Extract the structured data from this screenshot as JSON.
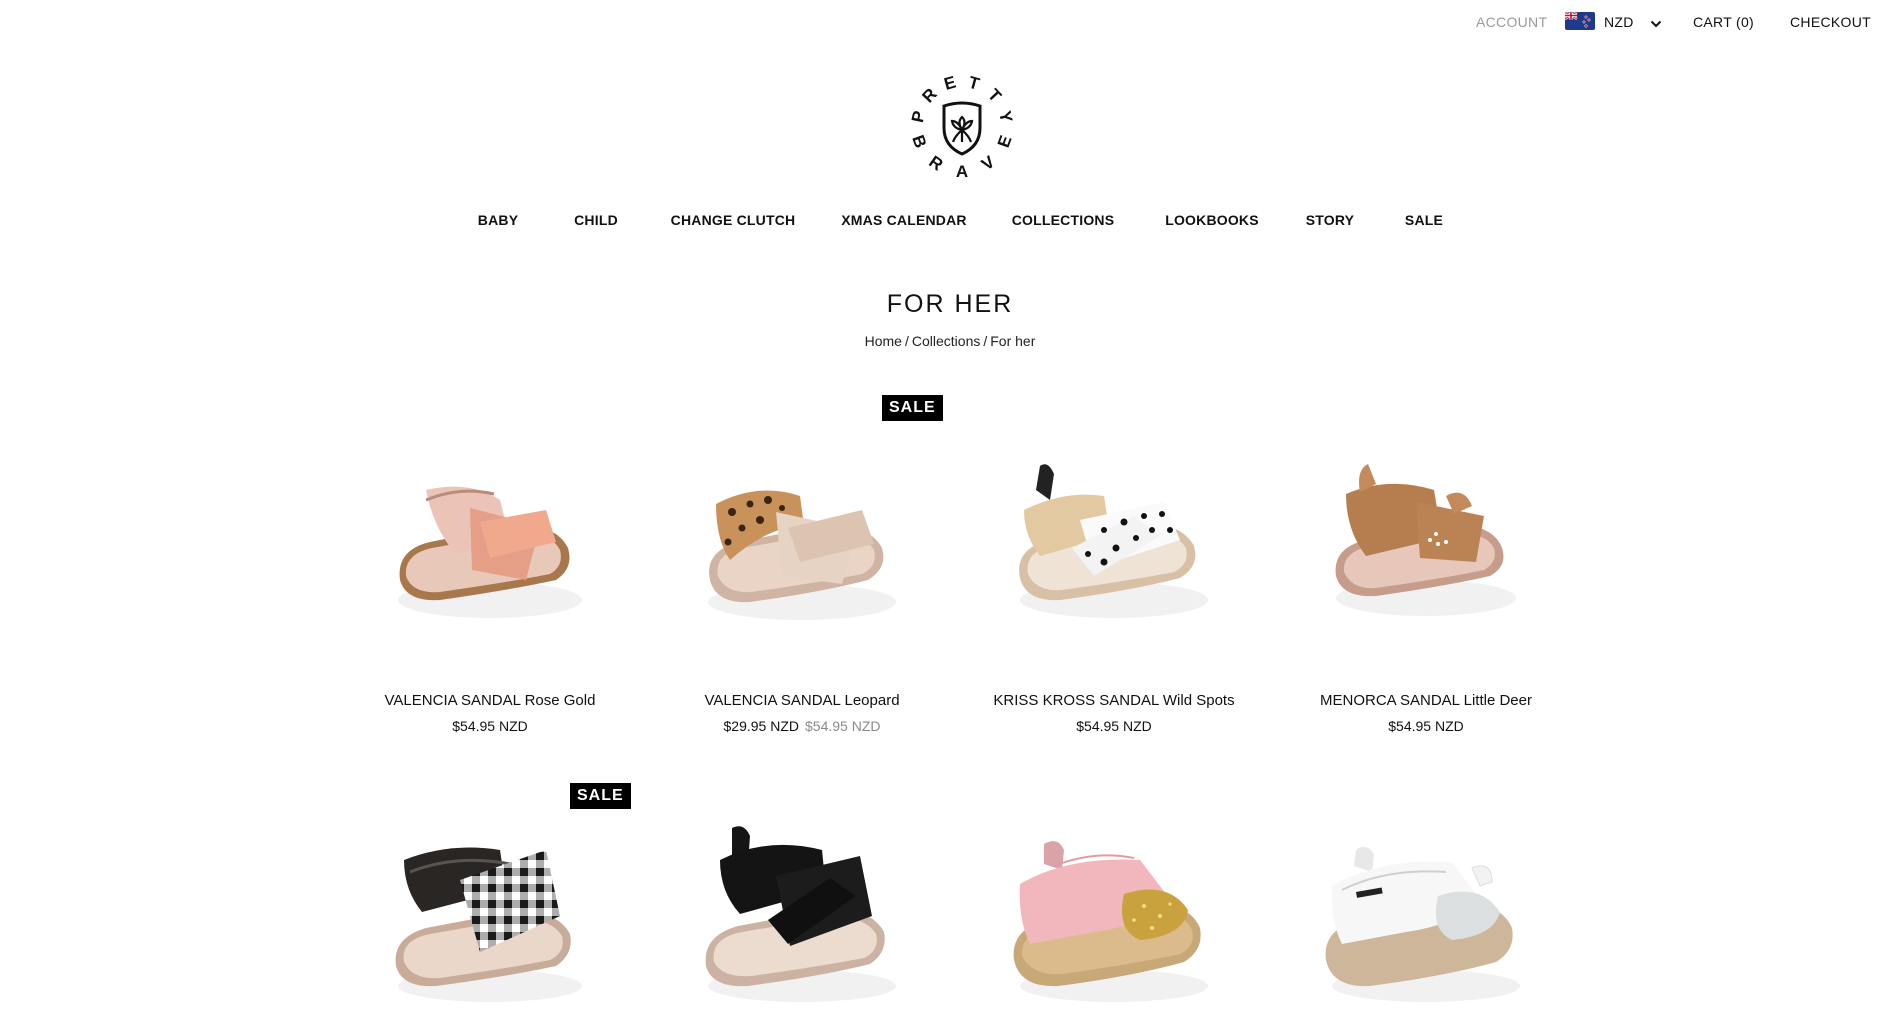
{
  "header": {
    "account": "ACCOUNT",
    "currency": "NZD",
    "cart": "CART (0)",
    "checkout": "CHECKOUT"
  },
  "logo": {
    "top_arc": "PRETTY",
    "bottom_arc": "BRAVE"
  },
  "nav": [
    {
      "label": "BABY"
    },
    {
      "label": "CHILD"
    },
    {
      "label": "CHANGE CLUTCH"
    },
    {
      "label": "XMAS CALENDAR"
    },
    {
      "label": "COLLECTIONS"
    },
    {
      "label": "LOOKBOOKS"
    },
    {
      "label": "STORY"
    },
    {
      "label": "SALE"
    }
  ],
  "page": {
    "title": "FOR HER",
    "breadcrumb": [
      "Home",
      "Collections",
      "For her"
    ],
    "separator": "/"
  },
  "products": [
    {
      "name": "VALENCIA SANDAL Rose Gold",
      "price": "$54.95 NZD",
      "compare_price": "",
      "badge": ""
    },
    {
      "name": "VALENCIA SANDAL Leopard",
      "price": "$29.95 NZD",
      "compare_price": "$54.95 NZD",
      "badge": "SALE"
    },
    {
      "name": "KRISS KROSS SANDAL Wild Spots",
      "price": "$54.95 NZD",
      "compare_price": "",
      "badge": ""
    },
    {
      "name": "MENORCA SANDAL Little Deer",
      "price": "$54.95 NZD",
      "compare_price": "",
      "badge": ""
    },
    {
      "name": "",
      "price": "",
      "compare_price": "",
      "badge": "SALE"
    },
    {
      "name": "",
      "price": "",
      "compare_price": "",
      "badge": ""
    },
    {
      "name": "",
      "price": "",
      "compare_price": "",
      "badge": ""
    },
    {
      "name": "",
      "price": "",
      "compare_price": "",
      "badge": ""
    }
  ]
}
